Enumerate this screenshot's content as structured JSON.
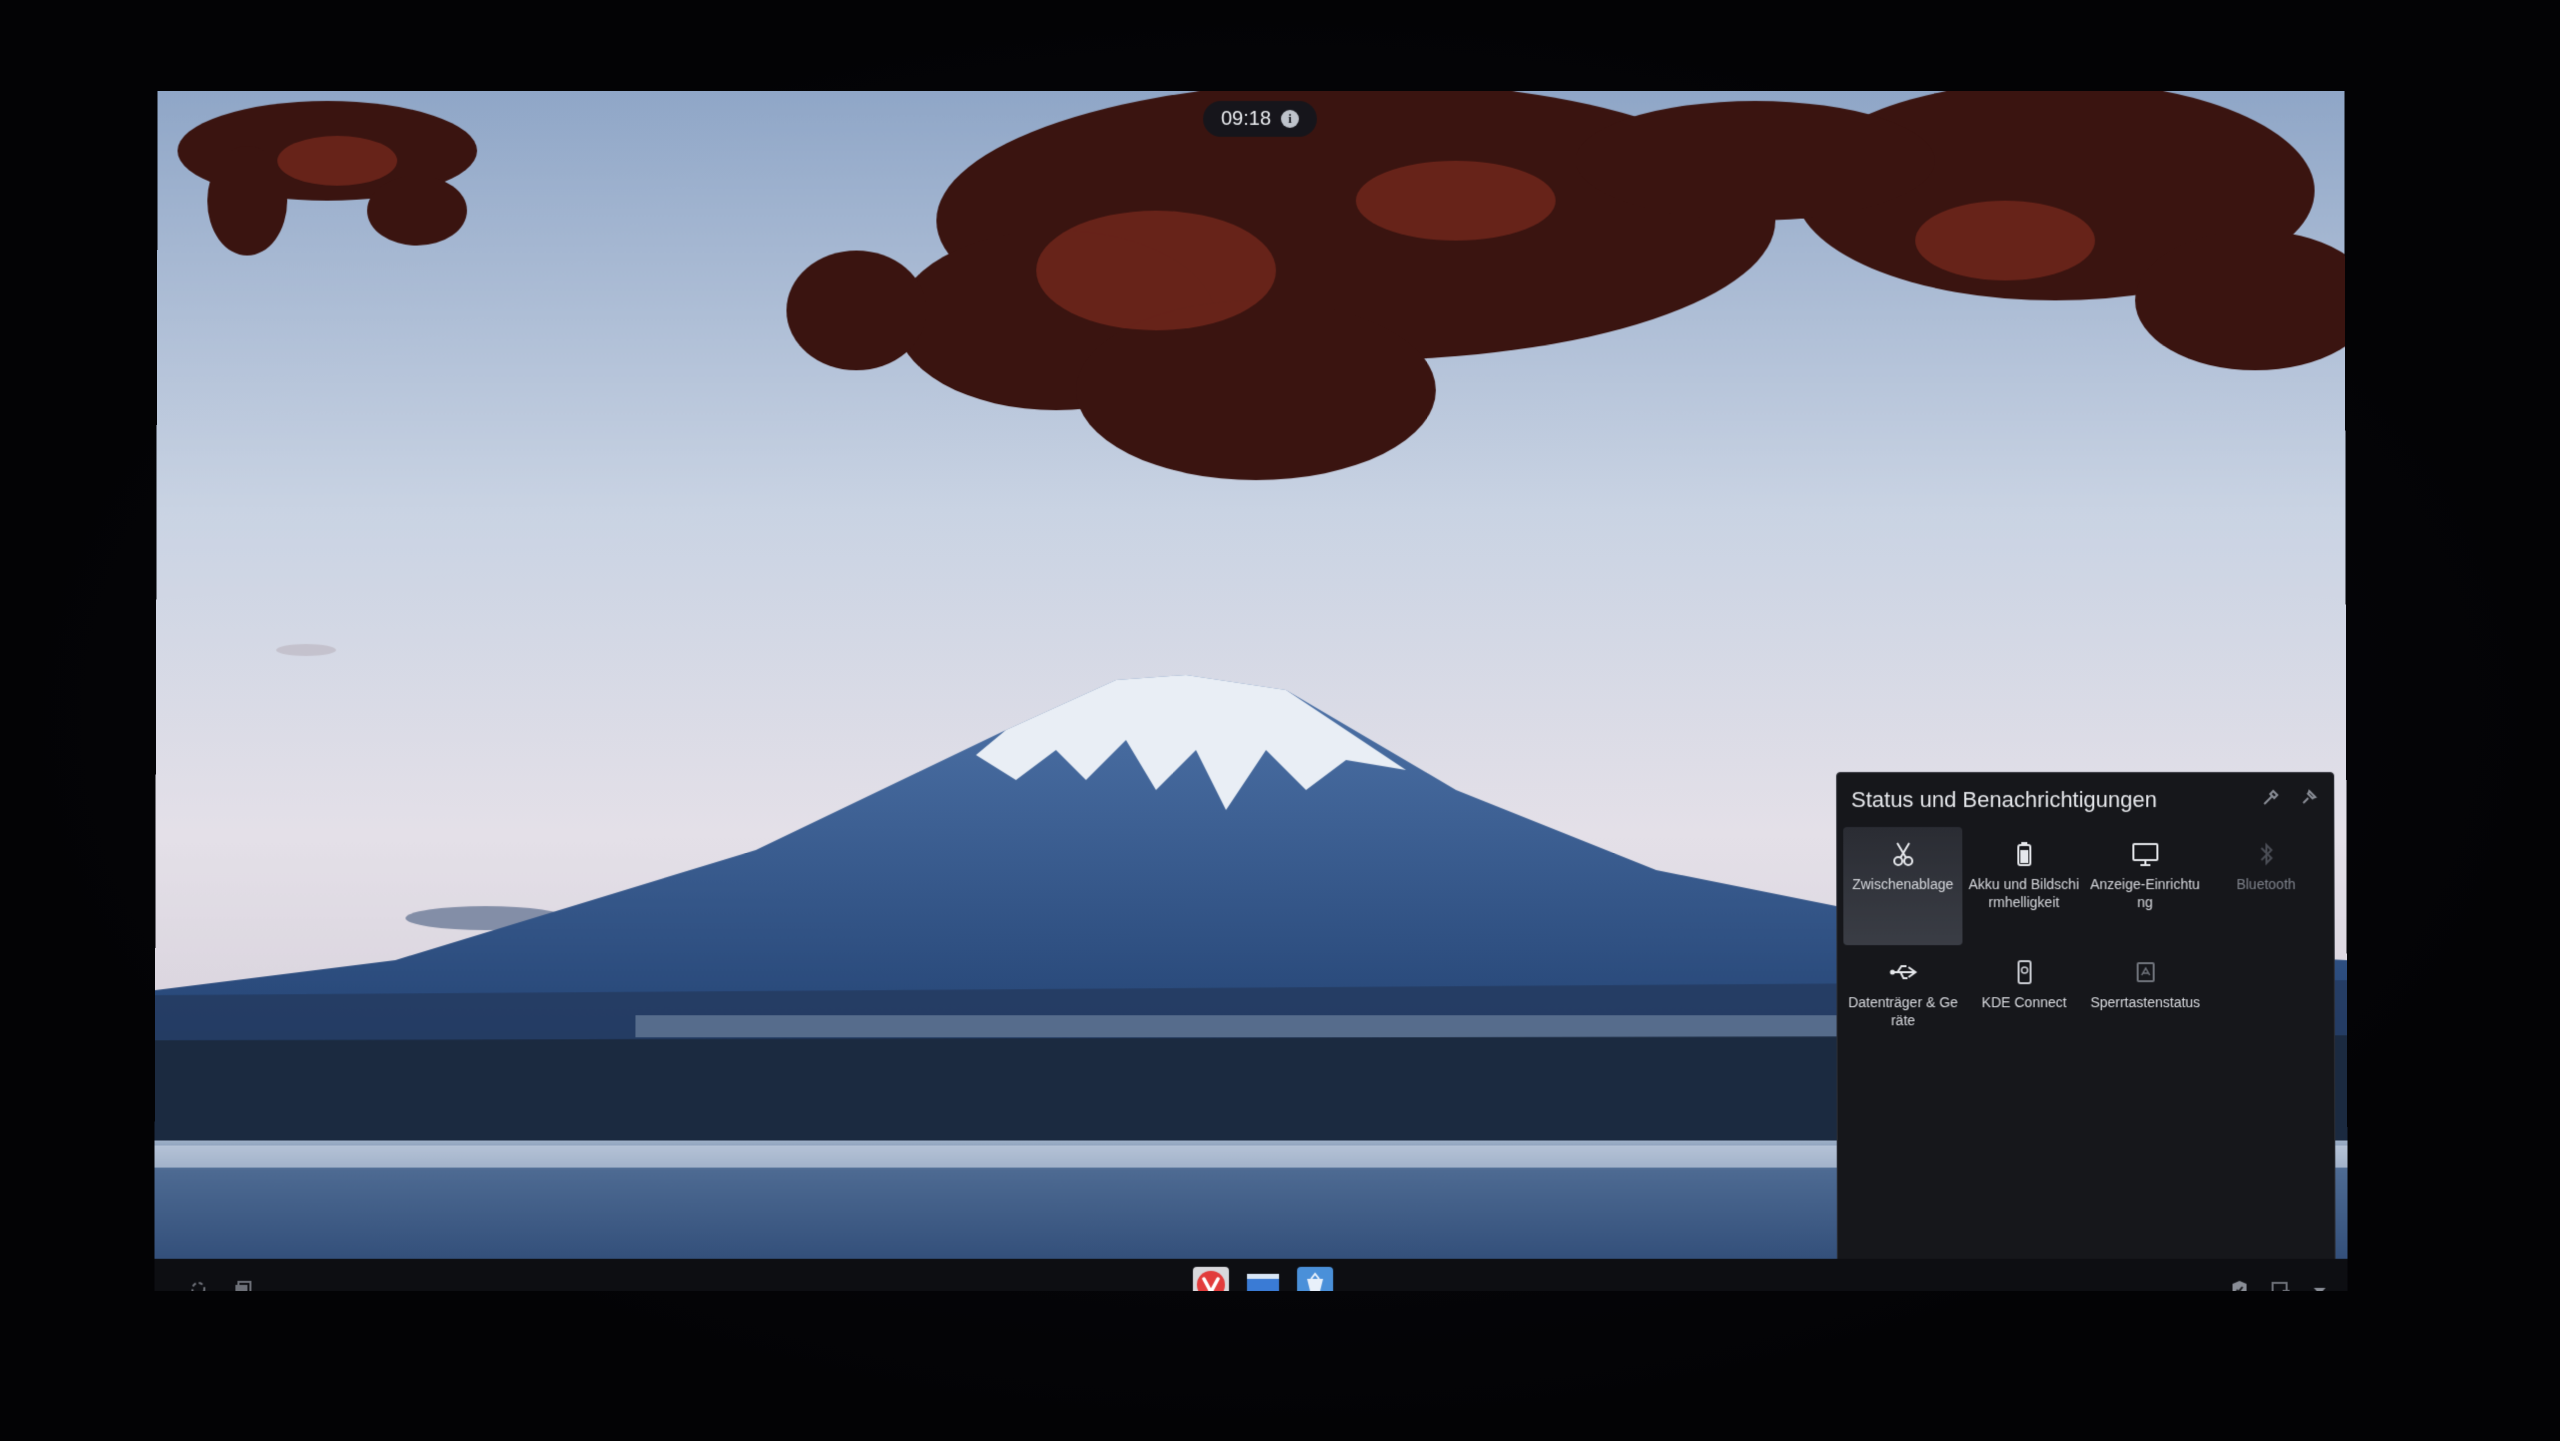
{
  "clock": {
    "time": "09:18",
    "icon": "info-icon"
  },
  "popup": {
    "title": "Status und Benachrichtigungen",
    "actions": [
      "configure-icon",
      "pin-icon"
    ],
    "tiles": [
      {
        "label": "Zwischenablage",
        "icon": "clipboard-scissors-icon",
        "active": true
      },
      {
        "label": "Akku und Bildschirmhelligkeit",
        "icon": "battery-icon",
        "active": false
      },
      {
        "label": "Anzeige-Einrichtung",
        "icon": "monitor-icon",
        "active": false
      },
      {
        "label": "Bluetooth",
        "icon": "bluetooth-icon",
        "active": false,
        "dimmed": true
      },
      {
        "label": "Datenträger & Geräte",
        "icon": "usb-icon",
        "active": false
      },
      {
        "label": "KDE Connect",
        "icon": "phone-icon",
        "active": false
      },
      {
        "label": "Sperrtastenstatus",
        "icon": "keyboard-lock-icon",
        "active": false
      }
    ]
  },
  "taskbar": {
    "left": [
      "activities-icon",
      "desktop-icon"
    ],
    "apps": [
      {
        "name": "Vivaldi",
        "icon": "vivaldi-icon",
        "color": "#e23b3b"
      },
      {
        "name": "Dolphin",
        "icon": "folder-icon",
        "color": "#3a7bd5"
      },
      {
        "name": "Discover",
        "icon": "discover-icon",
        "color": "#4a90d9"
      }
    ],
    "tray": [
      "shield-icon",
      "network-icon",
      "tray-expand-icon"
    ]
  },
  "colors": {
    "panel_bg": "#16171b",
    "accent": "#3daee9"
  }
}
